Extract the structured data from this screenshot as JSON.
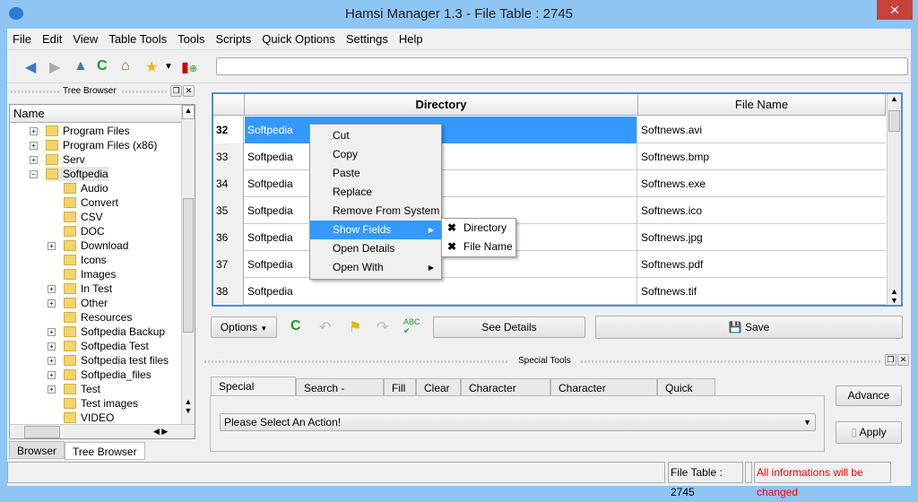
{
  "window": {
    "title": "Hamsi Manager 1.3 - File Table : 2745",
    "close": "✕"
  },
  "menu": [
    "File",
    "Edit",
    "View",
    "Table Tools",
    "Tools",
    "Scripts",
    "Quick Options",
    "Settings",
    "Help"
  ],
  "toolbar": {
    "icons": [
      "back-arrow-icon",
      "forward-arrow-icon",
      "up-arrow-icon",
      "refresh-icon",
      "home-icon",
      "star-icon",
      "add-bookmark-icon"
    ],
    "address": ""
  },
  "tree": {
    "panel_title": "Tree Browser",
    "header": "Name",
    "items": [
      {
        "label": "Program Files",
        "level": 0,
        "expand": true
      },
      {
        "label": "Program Files (x86)",
        "level": 0,
        "expand": true
      },
      {
        "label": "Serv",
        "level": 0,
        "expand": true
      },
      {
        "label": "Softpedia",
        "level": 0,
        "expand": "open",
        "selected": true
      },
      {
        "label": "Audio",
        "level": 1
      },
      {
        "label": "Convert",
        "level": 1
      },
      {
        "label": "CSV",
        "level": 1
      },
      {
        "label": "DOC",
        "level": 1
      },
      {
        "label": "Download",
        "level": 1,
        "expand": true
      },
      {
        "label": "Icons",
        "level": 1
      },
      {
        "label": "Images",
        "level": 1
      },
      {
        "label": "In Test",
        "level": 1,
        "expand": true
      },
      {
        "label": "Other",
        "level": 1,
        "expand": true
      },
      {
        "label": "Resources",
        "level": 1
      },
      {
        "label": "Softpedia Backup",
        "level": 1,
        "expand": true
      },
      {
        "label": "Softpedia Test",
        "level": 1,
        "expand": true
      },
      {
        "label": "Softpedia test files",
        "level": 1,
        "expand": true
      },
      {
        "label": "Softpedia_files",
        "level": 1,
        "expand": true
      },
      {
        "label": "Test",
        "level": 1,
        "expand": true
      },
      {
        "label": "Test images",
        "level": 1
      },
      {
        "label": "VIDEO",
        "level": 1
      }
    ]
  },
  "left_tabs": [
    "Browser",
    "Tree Browser"
  ],
  "table": {
    "columns": [
      "Directory",
      "File Name"
    ],
    "rows": [
      {
        "n": "32",
        "dir": "Softpedia",
        "file": "Softnews.avi"
      },
      {
        "n": "33",
        "dir": "Softpedia",
        "file": "Softnews.bmp"
      },
      {
        "n": "34",
        "dir": "Softpedia",
        "file": "Softnews.exe"
      },
      {
        "n": "35",
        "dir": "Softpedia",
        "file": "Softnews.ico"
      },
      {
        "n": "36",
        "dir": "Softpedia",
        "file": "Softnews.jpg"
      },
      {
        "n": "37",
        "dir": "Softpedia",
        "file": "Softnews.pdf"
      },
      {
        "n": "38",
        "dir": "Softpedia",
        "file": "Softnews.tif"
      }
    ]
  },
  "context_menu": {
    "items": [
      "Cut",
      "Copy",
      "Paste",
      "Replace",
      "Remove From System",
      "Show Fields",
      "Open Details",
      "Open With"
    ],
    "submenu": [
      "Directory",
      "File Name"
    ]
  },
  "actions": {
    "options": "Options",
    "see_details": "See Details",
    "save": "Save"
  },
  "special": {
    "title": "Special Tools",
    "tabs": [
      "Special Actions",
      "Search - Replace",
      "Fill",
      "Clear",
      "Character State",
      "Character Encoding",
      "Quick Fill"
    ],
    "select": "Please Select An Action!",
    "advance": "Advance",
    "apply": "Apply"
  },
  "status": {
    "count": "File Table : 2745",
    "warning": "All informations will be changed",
    "warning_color": "#ff0000"
  },
  "colors": {
    "selection": "#3399ff",
    "frame": "#8ec5f3"
  }
}
